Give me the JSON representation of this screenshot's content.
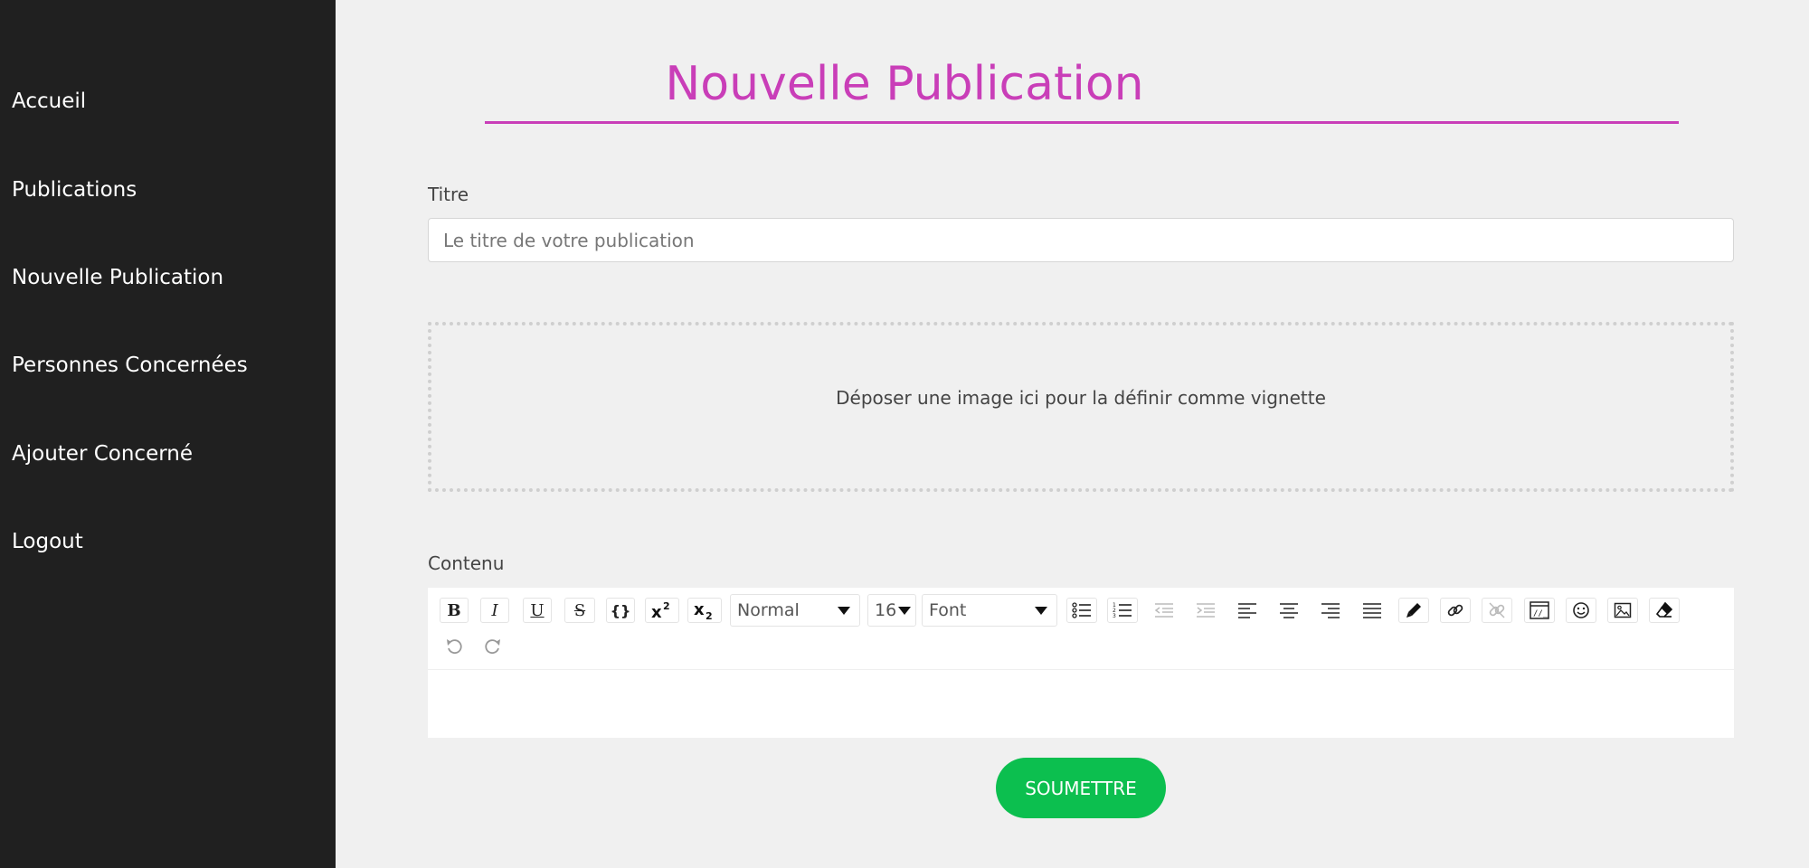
{
  "sidebar": {
    "items": [
      {
        "label": "Accueil"
      },
      {
        "label": "Publications"
      },
      {
        "label": "Nouvelle Publication"
      },
      {
        "label": "Personnes Concernées"
      },
      {
        "label": "Ajouter Concerné"
      },
      {
        "label": "Logout"
      }
    ]
  },
  "main": {
    "title": "Nouvelle Publication",
    "title_field": {
      "label": "Titre",
      "placeholder": "Le titre de votre publication",
      "value": ""
    },
    "dropzone": {
      "text": "Déposer une image ici pour la définir comme vignette"
    },
    "content_field": {
      "label": "Contenu"
    },
    "editor": {
      "style_select": "Normal",
      "size_select": "16",
      "font_select": "Font",
      "buttons": {
        "bold": "B",
        "italic": "I",
        "underline": "U",
        "strikethrough": "S",
        "code": "{}"
      }
    },
    "submit_label": "SOUMETTRE"
  },
  "colors": {
    "sidebar_bg": "#202020",
    "accent": "#c93eb8",
    "submit": "#0cbf4f",
    "page_bg": "#f0f0f0"
  }
}
